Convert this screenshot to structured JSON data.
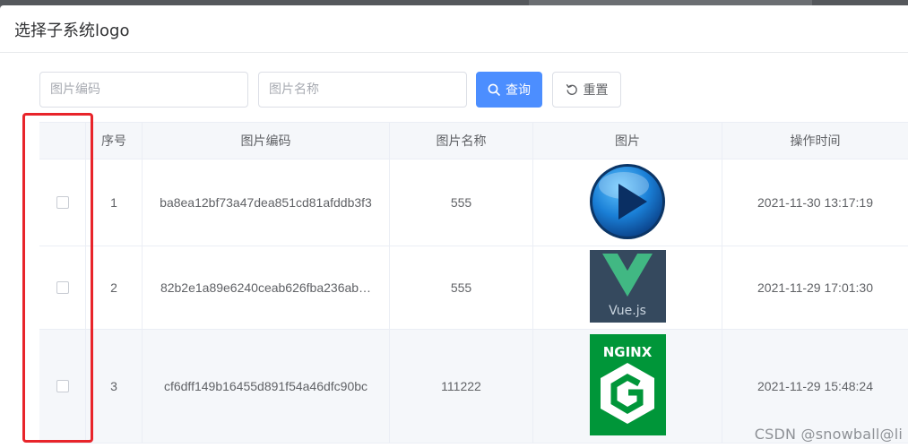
{
  "dialog": {
    "title": "选择子系统logo"
  },
  "search": {
    "code_placeholder": "图片编码",
    "name_placeholder": "图片名称",
    "query_label": "查询",
    "reset_label": "重置"
  },
  "table": {
    "headers": {
      "index": "序号",
      "code": "图片编码",
      "name": "图片名称",
      "image": "图片",
      "time": "操作时间"
    },
    "rows": [
      {
        "index": "1",
        "code": "ba8ea12bf73a47dea851cd81afddb3f3",
        "name": "555",
        "image": "play-button-logo",
        "time": "2021-11-30 13:17:19"
      },
      {
        "index": "2",
        "code": "82b2e1a89e6240ceab626fba236ab…",
        "name": "555",
        "image": "vuejs-logo",
        "image_text": "Vue.js",
        "time": "2021-11-29 17:01:30"
      },
      {
        "index": "3",
        "code": "cf6dff149b16455d891f54a46dfc90bc",
        "name": "111222",
        "image": "nginx-logo",
        "image_text": "NGINX",
        "time": "2021-11-29 15:48:24"
      }
    ]
  },
  "watermark": "CSDN @snowball@li",
  "colors": {
    "primary": "#4c8eff",
    "highlight": "#e8242a",
    "nginx_green": "#009639",
    "vue_green": "#41b883",
    "vue_bg": "#35495e"
  }
}
